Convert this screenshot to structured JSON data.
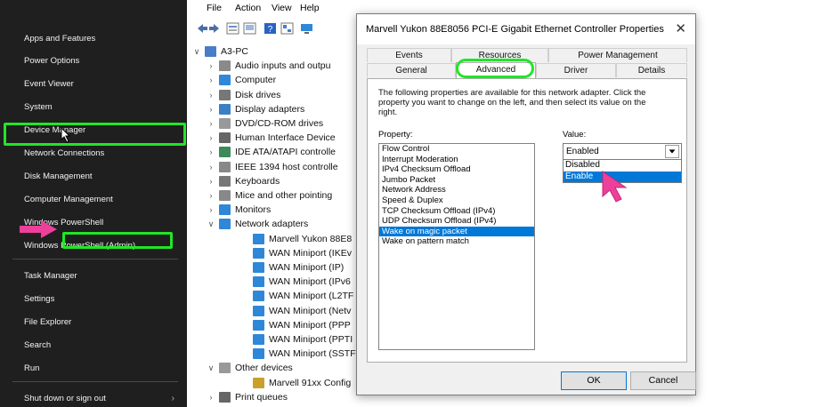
{
  "winx_menu": {
    "items": [
      {
        "label": "Apps and Features"
      },
      {
        "label": "Power Options"
      },
      {
        "label": "Event Viewer"
      },
      {
        "label": "System"
      },
      {
        "label": "Device Manager"
      },
      {
        "label": "Network Connections"
      },
      {
        "label": "Disk Management"
      },
      {
        "label": "Computer Management"
      },
      {
        "label": "Windows PowerShell"
      },
      {
        "label": "Windows PowerShell (Admin)"
      },
      {
        "label": "Task Manager"
      },
      {
        "label": "Settings"
      },
      {
        "label": "File Explorer"
      },
      {
        "label": "Search"
      },
      {
        "label": "Run"
      },
      {
        "label": "Shut down or sign out"
      }
    ],
    "highlighted": "Device Manager"
  },
  "device_manager": {
    "menu": [
      "File",
      "Action",
      "View",
      "Help"
    ],
    "tree": [
      {
        "label": "A3-PC",
        "icon": "computer-icon"
      },
      {
        "label": "Audio inputs and outpu",
        "icon": "speaker-icon"
      },
      {
        "label": "Computer",
        "icon": "monitor-icon"
      },
      {
        "label": "Disk drives",
        "icon": "disk-icon"
      },
      {
        "label": "Display adapters",
        "icon": "display-icon"
      },
      {
        "label": "DVD/CD-ROM drives",
        "icon": "dvd-icon"
      },
      {
        "label": "Human Interface Device",
        "icon": "hid-icon"
      },
      {
        "label": "IDE ATA/ATAPI controlle",
        "icon": "ide-icon"
      },
      {
        "label": "IEEE 1394 host controlle",
        "icon": "firewire-icon"
      },
      {
        "label": "Keyboards",
        "icon": "keyboard-icon"
      },
      {
        "label": "Mice and other pointing",
        "icon": "mouse-icon"
      },
      {
        "label": "Monitors",
        "icon": "monitor-icon"
      },
      {
        "label": "Network adapters",
        "icon": "network-icon"
      },
      {
        "label": "Marvell Yukon 88E8",
        "icon": "network-card-icon"
      },
      {
        "label": "WAN Miniport (IKEv",
        "icon": "network-card-icon"
      },
      {
        "label": "WAN Miniport (IP)",
        "icon": "network-card-icon"
      },
      {
        "label": "WAN Miniport (IPv6",
        "icon": "network-card-icon"
      },
      {
        "label": "WAN Miniport (L2TF",
        "icon": "network-card-icon"
      },
      {
        "label": "WAN Miniport (Netv",
        "icon": "network-card-icon"
      },
      {
        "label": "WAN Miniport (PPP",
        "icon": "network-card-icon"
      },
      {
        "label": "WAN Miniport (PPTI",
        "icon": "network-card-icon"
      },
      {
        "label": "WAN Miniport (SSTF",
        "icon": "network-card-icon"
      },
      {
        "label": "Other devices",
        "icon": "unknown-device-icon"
      },
      {
        "label": "Marvell 91xx Config",
        "icon": "warning-device-icon"
      },
      {
        "label": "Print queues",
        "icon": "printer-icon"
      }
    ]
  },
  "dialog": {
    "title": "Marvell Yukon 88E8056 PCI-E Gigabit Ethernet Controller Properties",
    "close_glyph": "✕",
    "tabs_back": [
      "Events",
      "Resources",
      "Power Management"
    ],
    "tabs_front": [
      "General",
      "Advanced",
      "Driver",
      "Details"
    ],
    "active_tab": "Advanced",
    "description": "The following properties are available for this network adapter. Click the property you want to change on the left, and then select its value on the right.",
    "property_label": "Property:",
    "value_label": "Value:",
    "properties": [
      "Flow Control",
      "Interrupt Moderation",
      "IPv4 Checksum Offload",
      "Jumbo Packet",
      "Network Address",
      "Speed & Duplex",
      "TCP Checksum Offload (IPv4)",
      "UDP Checksum Offload (IPv4)",
      "Wake on magic packet",
      "Wake on pattern match"
    ],
    "selected_property": "Wake on magic packet",
    "value_selected": "Enabled",
    "value_options": [
      "Disabled",
      "Enable"
    ],
    "ok_label": "OK",
    "cancel_label": "Cancel"
  },
  "colors": {
    "highlight_green": "#21e626",
    "pointer_pink": "#ee3f9a",
    "selection_blue": "#0078d7"
  }
}
